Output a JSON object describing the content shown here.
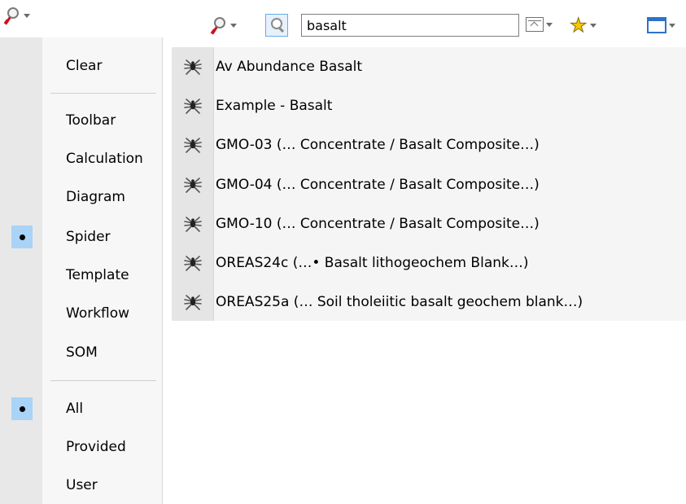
{
  "filter_button": {
    "icon": "filter-search-icon",
    "accent": "#cc1020"
  },
  "filter_menu": {
    "clear": "Clear",
    "categories": [
      {
        "label": "Toolbar",
        "selected": false
      },
      {
        "label": "Calculation",
        "selected": false
      },
      {
        "label": "Diagram",
        "selected": false
      },
      {
        "label": "Spider",
        "selected": true
      },
      {
        "label": "Template",
        "selected": false
      },
      {
        "label": "Workflow",
        "selected": false
      },
      {
        "label": "SOM",
        "selected": false
      }
    ],
    "sources": [
      {
        "label": "All",
        "selected": true
      },
      {
        "label": "Provided",
        "selected": false
      },
      {
        "label": "User",
        "selected": false
      }
    ],
    "selection_color": "#a9d3f7"
  },
  "search": {
    "value": "basalt",
    "placeholder": ""
  },
  "toolbar": {
    "icons": [
      "filter-search-icon",
      "search-toggle-icon",
      "panel-icon",
      "star-icon",
      "window-icon"
    ]
  },
  "results": [
    "Av Abundance Basalt",
    "Example - Basalt",
    "GMO-03 (… Concentrate / Basalt Composite…)",
    "GMO-04 (… Concentrate / Basalt Composite…)",
    "GMO-10 (… Concentrate / Basalt Composite…)",
    "OREAS24c (…• Basalt lithogeochem Blank…)",
    "OREAS25a (… Soil tholeiitic basalt geochem blank…)"
  ]
}
